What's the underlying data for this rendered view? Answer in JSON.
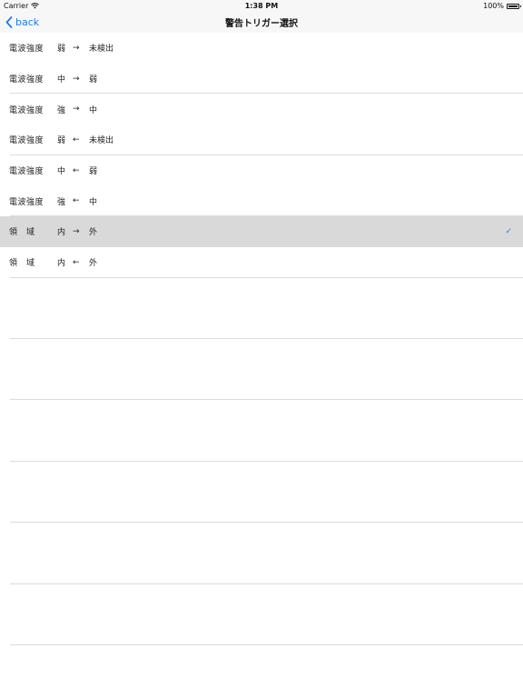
{
  "status_bar": {
    "carrier": "Carrier",
    "time": "1:38 PM",
    "battery": "100%",
    "wifi_icon": "wifi-icon",
    "battery_icon": "battery-icon"
  },
  "nav": {
    "back_label": "back",
    "back_icon": "chevron-left-icon",
    "title": "警告トリガー選択"
  },
  "triggers": [
    {
      "label": "電波強度",
      "from": "弱",
      "arrow": "→",
      "to": "未検出",
      "selected": false
    },
    {
      "label": "電波強度",
      "from": "中",
      "arrow": "→",
      "to": "弱",
      "selected": false
    },
    {
      "label": "電波強度",
      "from": "強",
      "arrow": "→",
      "to": "中",
      "selected": false
    },
    {
      "label": "電波強度",
      "from": "弱",
      "arrow": "←",
      "to": "未検出",
      "selected": false
    },
    {
      "label": "電波強度",
      "from": "中",
      "arrow": "←",
      "to": "弱",
      "selected": false
    },
    {
      "label": "電波強度",
      "from": "強",
      "arrow": "←",
      "to": "中",
      "selected": false
    },
    {
      "label": "領　域",
      "from": "内",
      "arrow": "→",
      "to": "外",
      "selected": true
    },
    {
      "label": "領　域",
      "from": "内",
      "arrow": "←",
      "to": "外",
      "selected": false
    }
  ],
  "checkmark": "✓",
  "colors": {
    "accent": "#1a7cf5",
    "selected_row": "#d9d9d9",
    "separator": "#dcdcdc"
  }
}
